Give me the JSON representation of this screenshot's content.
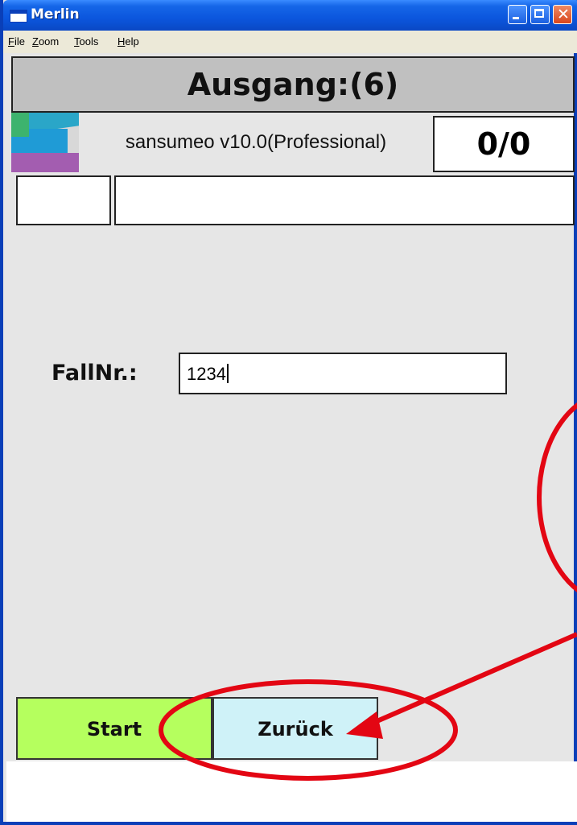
{
  "window": {
    "title": "Merlin"
  },
  "menu": {
    "items": [
      "File",
      "Zoom",
      "Tools",
      "Help"
    ]
  },
  "header": {
    "title": "Ausgang:(6)"
  },
  "info": {
    "version": "sansumeo v10.0(Professional)",
    "counter": "0/0"
  },
  "form": {
    "label": "FallNr.:",
    "value": "1234"
  },
  "buttons": {
    "start": "Start",
    "back": "Zurück"
  },
  "colors": {
    "start": "#b5ff5e",
    "back": "#cff2f8",
    "annotation": "#e30613"
  },
  "icons": {
    "app": "app-window-icon",
    "logo": "sansumeo-logo"
  }
}
